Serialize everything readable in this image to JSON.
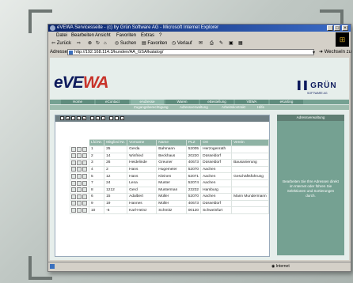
{
  "window": {
    "title": "eVEWA Servicesseite - (c) by Grün Software AG - Microsoft Internet Explorer"
  },
  "menu": [
    "Datei",
    "Bearbeiten",
    "Ansicht",
    "Favoriten",
    "Extras",
    "?"
  ],
  "toolbar": {
    "back": "Zurück",
    "search": "Suchen",
    "favorites": "Favoriten",
    "history": "Verlauf"
  },
  "address": {
    "label": "Adresse",
    "url": "http://192.168.114.3/kunden/AA_GSA/katalog/",
    "go": "Wechseln zu"
  },
  "brand": {
    "logo_main": "eVE",
    "logo_accent": "WA",
    "company": "GRÜN",
    "company_sub": "SOFTWARE AG"
  },
  "nav": [
    "Home",
    "eContact",
    "eAdresse",
    "Waren",
    "eBestellung",
    "VBWA",
    "eKarting"
  ],
  "subnav": [
    "Zugangsberechtigung",
    "Adressverwaltung",
    "Arbeitskontrakt",
    "Hilfe"
  ],
  "table": {
    "headers": [
      "Lfd.Nr.",
      "Mitglied Nr.",
      "Vorname",
      "Name",
      "PLZ",
      "Ort",
      "Verein"
    ],
    "rows": [
      [
        "1",
        "25",
        "Gerda",
        "Bahmann",
        "52005",
        "Herzogenrath",
        ""
      ],
      [
        "2",
        "14",
        "Winfried",
        "Beckhaus",
        "20220",
        "Düsseldorf",
        ""
      ],
      [
        "3",
        "26",
        "Heidelinde",
        "Greuner",
        "40673",
        "Düsseldorf",
        "Bausanierung"
      ],
      [
        "4",
        "2",
        "Hans",
        "Hugemeier",
        "52070",
        "Aachen",
        ""
      ],
      [
        "5",
        "12",
        "Hans",
        "Kleinen",
        "52071",
        "Aachen",
        "Geschäftsführung"
      ],
      [
        "7",
        "24",
        "Lena",
        "Muster",
        "52074",
        "Aachen",
        ""
      ],
      [
        "8",
        "1212",
        "Gerd",
        "Musterman",
        "23232",
        "Hamburg",
        ""
      ],
      [
        "6",
        "15",
        "Adalbert",
        "Müller",
        "52070",
        "Aachen",
        "Mann Mundermann"
      ],
      [
        "9",
        "19",
        "Hannes",
        "Müller",
        "40673",
        "Düsseldorf",
        ""
      ],
      [
        "10",
        "-6",
        "Karl-Heinz",
        "Schmitz",
        "00120",
        "Schweinfurt",
        ""
      ]
    ]
  },
  "side": {
    "title": "Adressverwaltung",
    "text": "Bearbeiten Sie Ihre Adressen direkt im Internet oder führen Sie Selektionen und Sortierungen durch."
  },
  "status": {
    "zone": "Internet"
  },
  "colors": {
    "accent": "#75a192",
    "header": "#8fb3a5",
    "brand": "#0d1a5c",
    "logo_red": "#c8332a"
  }
}
